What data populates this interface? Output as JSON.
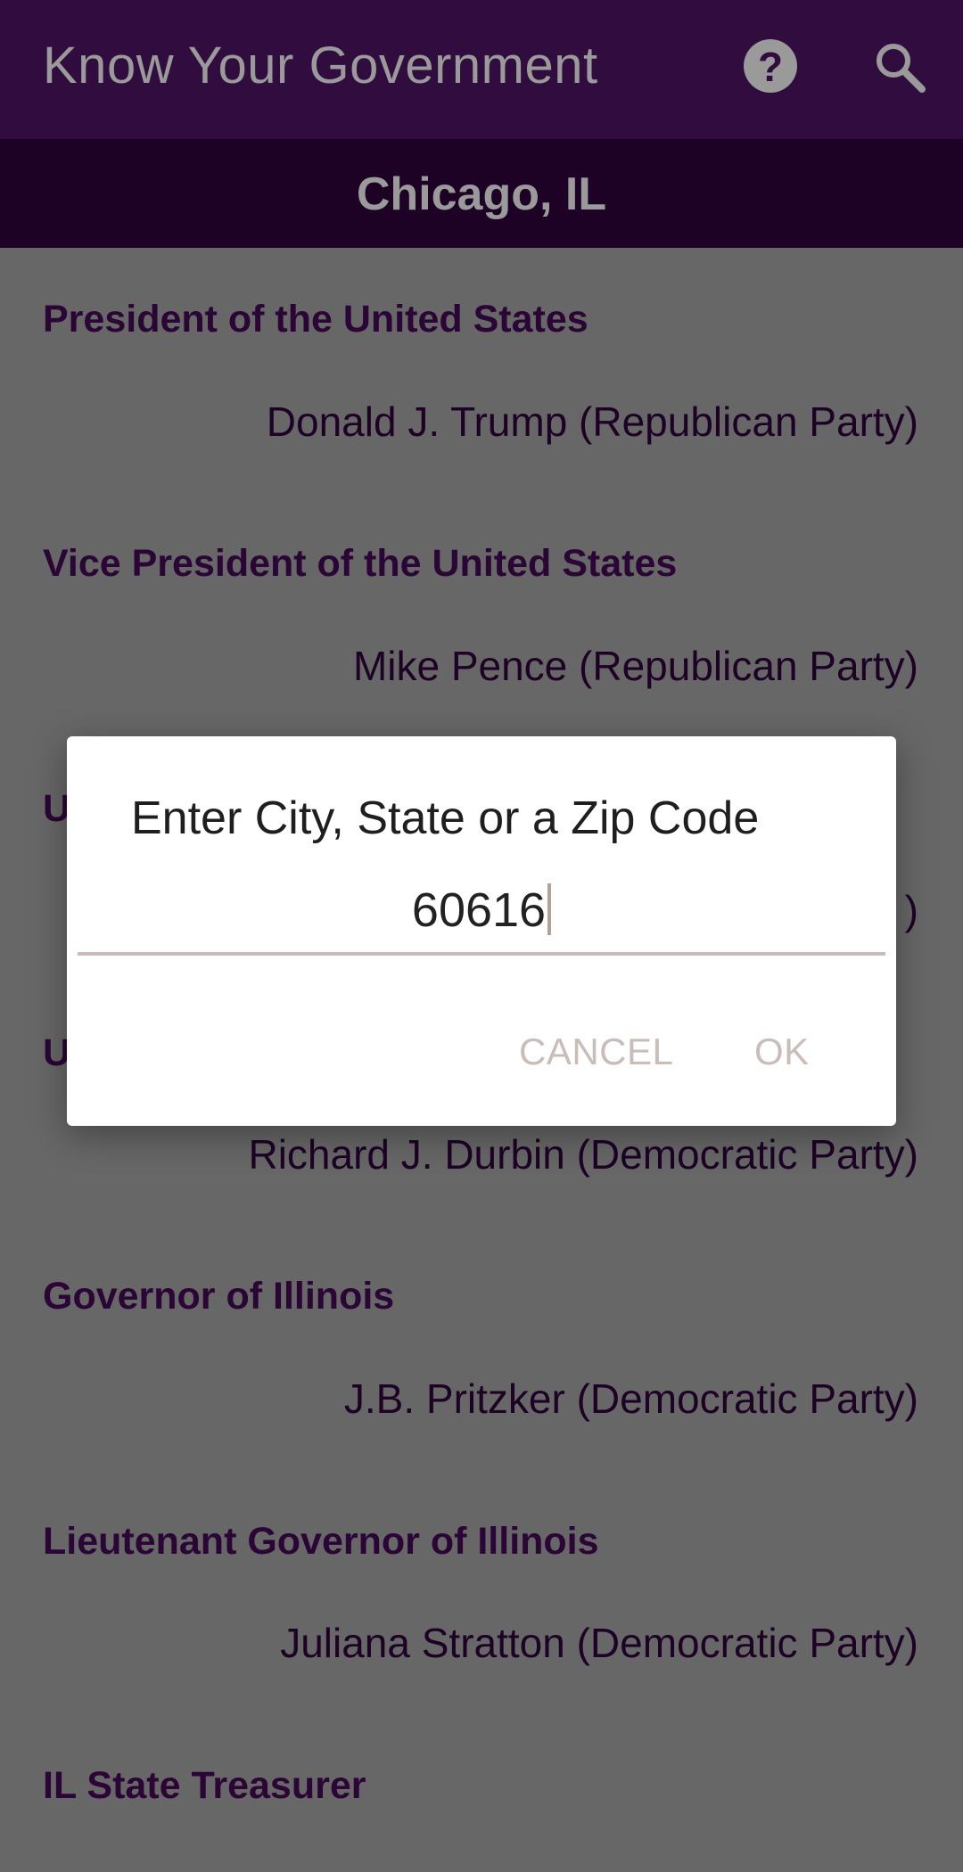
{
  "header": {
    "title": "Know Your Government",
    "help_icon": "help-circle-icon",
    "search_icon": "search-icon"
  },
  "location": "Chicago, IL",
  "officials": [
    {
      "office": "President of the United States",
      "name": "Donald J. Trump (Republican Party)"
    },
    {
      "office": "Vice President of the United States",
      "name": "Mike Pence (Republican Party)"
    },
    {
      "office": "U",
      "name": ")"
    },
    {
      "office": "U",
      "name": "Richard J. Durbin (Democratic Party)"
    },
    {
      "office": "Governor of Illinois",
      "name": "J.B. Pritzker (Democratic Party)"
    },
    {
      "office": "Lieutenant Governor of Illinois",
      "name": "Juliana Stratton (Democratic Party)"
    },
    {
      "office": "IL State Treasurer",
      "name": ""
    }
  ],
  "dialog": {
    "title": "Enter City, State or a Zip Code",
    "input_value": "60616",
    "cancel_label": "CANCEL",
    "ok_label": "OK"
  },
  "colors": {
    "toolbar": "#310c3e",
    "location_bar": "#1d0226",
    "office_text": "#2a0536",
    "dialog_button": "#c8bdb8"
  }
}
